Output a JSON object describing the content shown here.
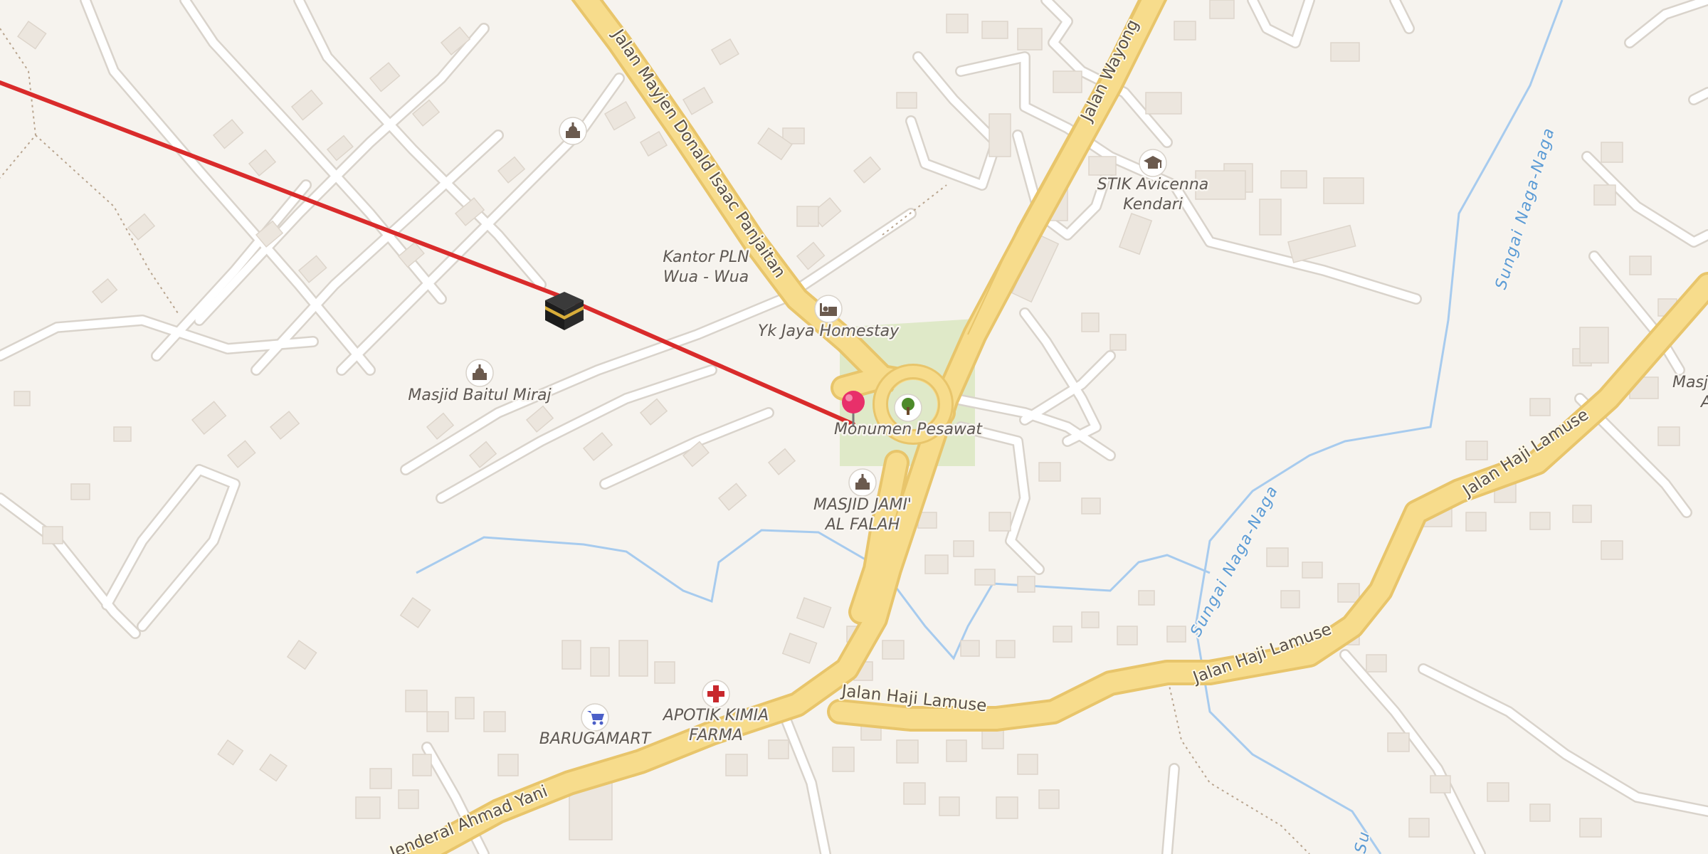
{
  "map": {
    "colors": {
      "background": "#f6f3ee",
      "park": "#dfe9c8",
      "main_road_fill": "#f7dc8c",
      "main_road_casing": "#e8c56b",
      "minor_road": "#ffffff",
      "minor_road_casing": "#d9d3cb",
      "river": "#a7cbee",
      "route_line": "#d92b2b",
      "pin": "#e8306a"
    },
    "roads": {
      "donald_isaac": "Jalan Mayjen Donald Isaac Panjaitan",
      "wayong": "Jalan Wayong",
      "haji_lamuse_1": "Jalan Haji Lamuse",
      "haji_lamuse_2": "Jalan Haji Lamuse",
      "haji_lamuse_3": "Jalan Haji Lamuse",
      "ahmad_yani": "Jenderal Ahmad Yani"
    },
    "rivers": {
      "naga_1": "Sungai Naga-Naga",
      "naga_2": "Sungai Naga-Naga",
      "naga_3": "Su"
    },
    "places": {
      "stik": "STIK Avicenna Kendari",
      "stik_line1": "STIK Avicenna",
      "stik_line2": "Kendari",
      "pln_line1": "Kantor PLN",
      "pln_line2": "Wua - Wua",
      "homestay": "Yk Jaya Homestay",
      "monumen": "Monumen Pesawat",
      "masjid_baitul": "Masjid Baitul Miraj",
      "masjid_jami_line1": "MASJID JAMI'",
      "masjid_jami_line2": "AL FALAH",
      "barugamart": "BARUGAMART",
      "apotik_line1": "APOTIK KIMIA",
      "apotik_line2": "FARMA",
      "edge_line1": "Masji",
      "edge_line2": "A"
    },
    "icons": {
      "kaaba": "kaaba-icon",
      "pin": "location-pin-icon",
      "mosque": "mosque-icon",
      "hotel": "bed-icon",
      "park": "tree-icon",
      "school": "graduation-cap-icon",
      "shop": "shopping-cart-icon",
      "pharmacy": "pharmacy-cross-icon"
    }
  }
}
